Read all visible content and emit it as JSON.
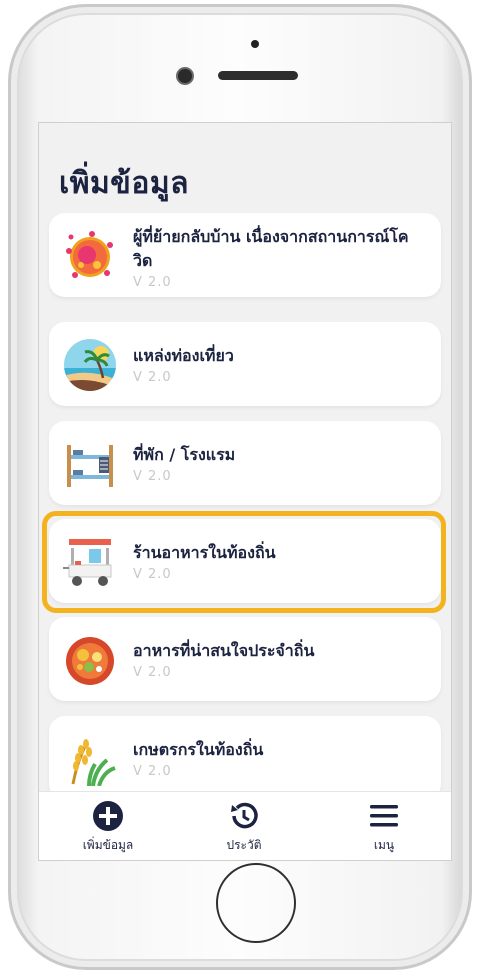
{
  "header": {
    "title": "เพิ่มข้อมูล"
  },
  "cards": [
    {
      "name": "ผู้ที่ย้ายกลับบ้าน เนื่องจากสถานการณ์โควิด",
      "version": "V 2.0",
      "icon": "virus-icon"
    },
    {
      "name": "แหล่งท่องเที่ยว",
      "version": "V 2.0",
      "icon": "beach-icon"
    },
    {
      "name": "ที่พัก / โรงแรม",
      "version": "V 2.0",
      "icon": "bunk-bed-icon"
    },
    {
      "name": "ร้านอาหารในท้องถิ่น",
      "version": "V 2.0",
      "icon": "food-cart-icon"
    },
    {
      "name": "อาหารที่น่าสนใจประจำถิ่น",
      "version": "V 2.0",
      "icon": "dish-icon"
    },
    {
      "name": "เกษตรกรในท้องถิ่น",
      "version": "V 2.0",
      "icon": "rice-plant-icon"
    }
  ],
  "tabs": [
    {
      "label": "เพิ่มข้อมูล",
      "icon": "add-circle-icon"
    },
    {
      "label": "ประวัติ",
      "icon": "history-icon"
    },
    {
      "label": "เมนู",
      "icon": "menu-icon"
    }
  ],
  "colors": {
    "text": "#1c2340",
    "version": "#c8c8c8",
    "highlight": "#f3b31e",
    "screen_bg": "#f1f1f1"
  }
}
